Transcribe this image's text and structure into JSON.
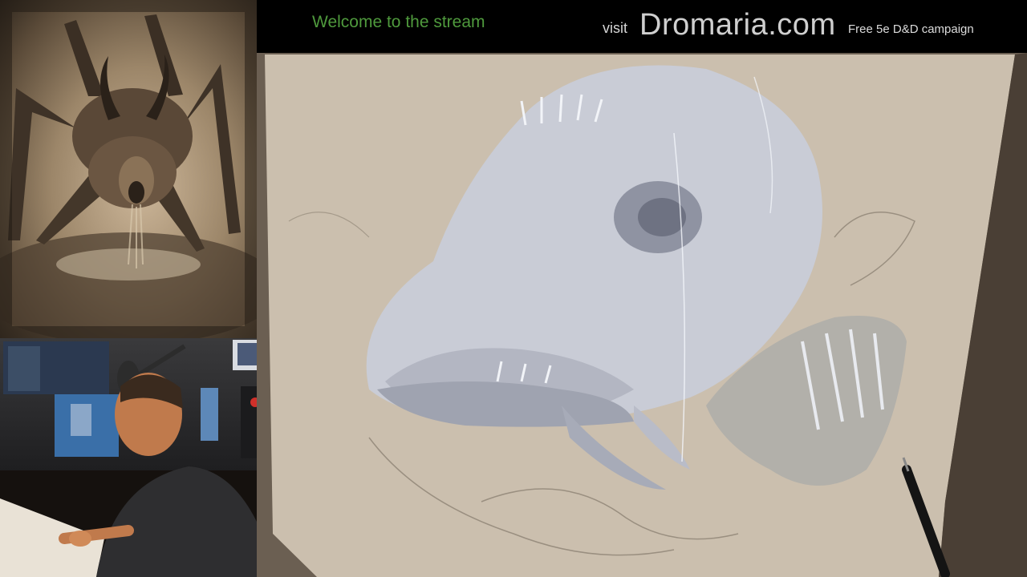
{
  "overlay": {
    "welcome_text": "Welcome to the stream",
    "visit_label": "visit",
    "site_name": "Dromaria.com",
    "tagline": "Free 5e D&D campaign"
  },
  "colors": {
    "welcome_green": "#4f9a3d",
    "paper_tan": "#cbbfae",
    "ink_blue_white": "#dfe6f0"
  },
  "panels": {
    "reference_image": "reference-artwork",
    "webcam": "artist-webcam",
    "main": "drawing-in-progress"
  }
}
